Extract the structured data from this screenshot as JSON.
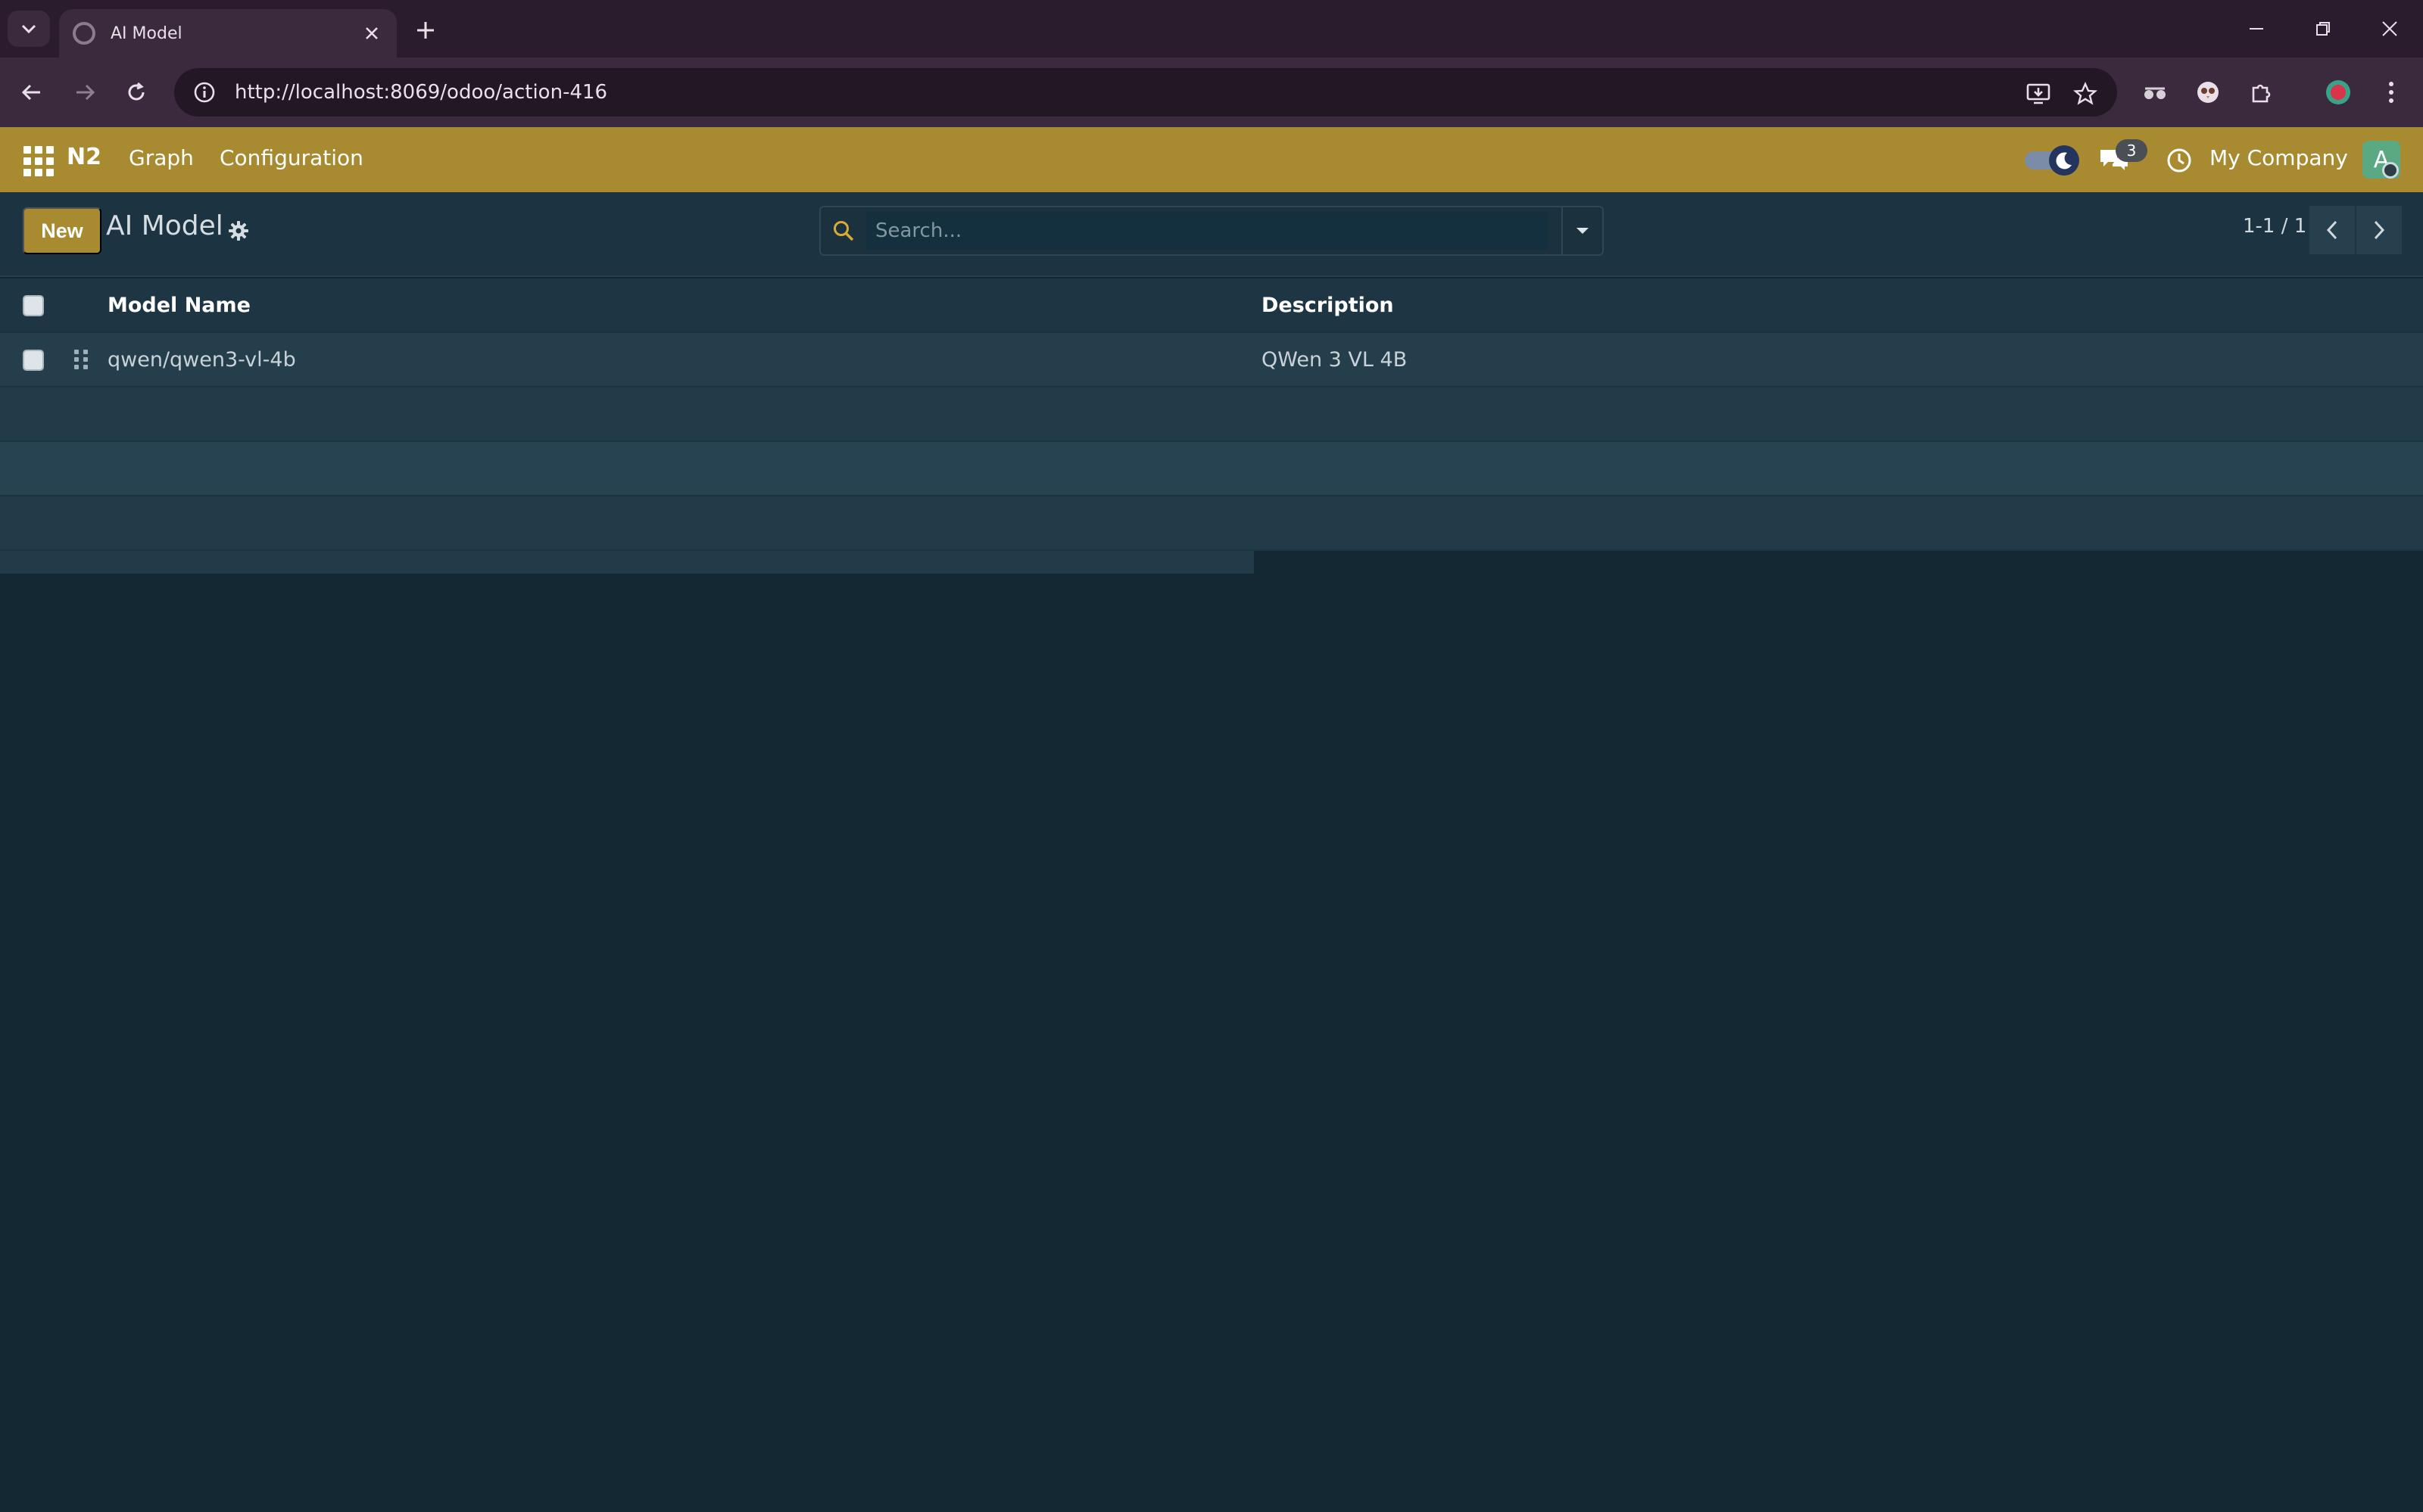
{
  "browser": {
    "tab_title": "AI Model",
    "url": "http://localhost:8069/odoo/action-416"
  },
  "navbar": {
    "brand": "N2",
    "menu_items": [
      "Graph",
      "Configuration"
    ],
    "chat_badge": "3",
    "company": "My Company",
    "avatar_letter": "A",
    "accent_color": "#a88a30"
  },
  "control_panel": {
    "new_label": "New",
    "title": "AI Model",
    "search_placeholder": "Search...",
    "pager_value": "1-1 / 1"
  },
  "list": {
    "columns": [
      "Model Name",
      "Description"
    ],
    "rows": [
      {
        "model_name": "qwen/qwen3-vl-4b",
        "description": "QWen 3 VL 4B"
      }
    ]
  }
}
